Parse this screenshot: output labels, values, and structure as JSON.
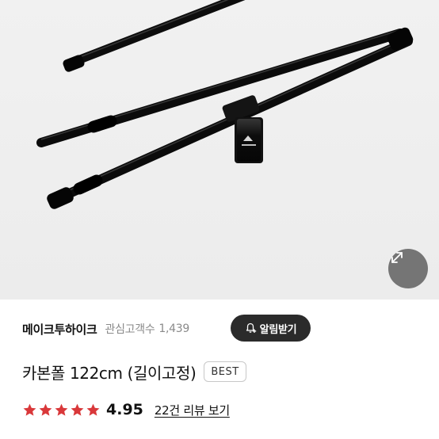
{
  "product_image": {
    "alt": "",
    "expand_icon": "expand-arrows-icon"
  },
  "seller": {
    "name": "메이크투하이크",
    "followers_label": "관심고객수",
    "followers_count": "1,439"
  },
  "alert_button": {
    "label": "알림받기",
    "icon": "bell-plus-icon"
  },
  "product": {
    "title": "카본폴 122cm (길이고정)",
    "badge": "BEST"
  },
  "rating": {
    "score": "4.95",
    "stars": 5,
    "star_color": "#d9383a",
    "reviews_label": "22건 리뷰 보기"
  },
  "colors": {
    "button_bg": "#2b2b2b",
    "star": "#d9383a"
  }
}
